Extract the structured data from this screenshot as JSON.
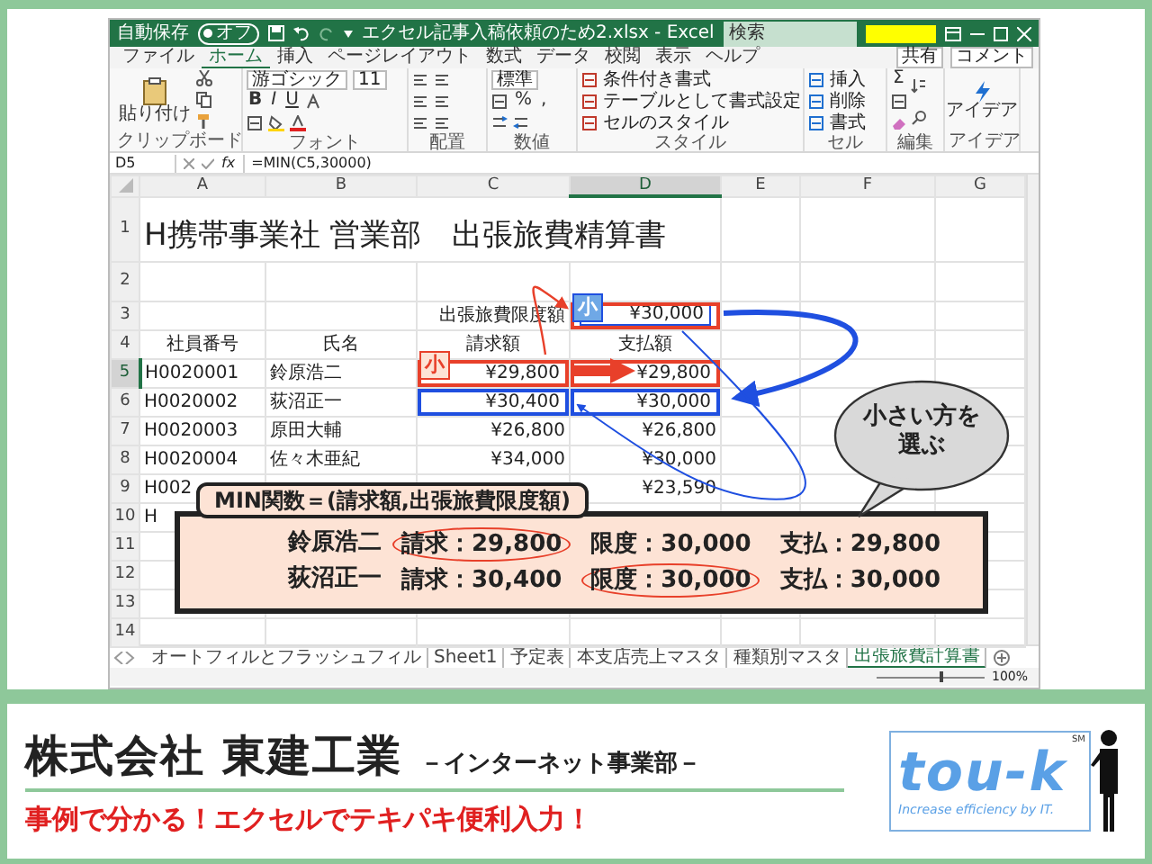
{
  "window": {
    "autosave_label": "自動保存",
    "autosave_on": false,
    "autosave_state": "オフ",
    "title": "エクセル記事入稿依頼のため2.xlsx - Excel",
    "search_placeholder": "検索"
  },
  "ribbon": {
    "tabs": [
      {
        "label": "ファイル",
        "selected": false
      },
      {
        "label": "ホーム",
        "selected": true
      },
      {
        "label": "挿入",
        "selected": false
      },
      {
        "label": "ページレイアウト",
        "selected": false
      },
      {
        "label": "数式",
        "selected": false
      },
      {
        "label": "データ",
        "selected": false
      },
      {
        "label": "校閲",
        "selected": false
      },
      {
        "label": "表示",
        "selected": false
      },
      {
        "label": "ヘルプ",
        "selected": false
      }
    ],
    "share": "共有",
    "comments": "コメント",
    "groups": [
      {
        "kind": "clipboard",
        "label": "クリップボード",
        "paste": "貼り付け"
      },
      {
        "kind": "font",
        "label": "フォント",
        "font_name": "游ゴシック",
        "font_size": "11",
        "buttons": [
          "B",
          "I",
          "U"
        ]
      },
      {
        "kind": "alignment",
        "label": "配置"
      },
      {
        "kind": "number",
        "label": "数値",
        "format": "標準",
        "buttons": [
          "%",
          ","
        ]
      },
      {
        "kind": "styles",
        "label": "スタイル",
        "items": [
          "条件付き書式",
          "テーブルとして書式設定",
          "セルのスタイル"
        ]
      },
      {
        "kind": "cells",
        "label": "セル",
        "items": [
          "挿入",
          "削除",
          "書式"
        ]
      },
      {
        "kind": "editing",
        "label": "編集",
        "buttons": [
          "Σ"
        ]
      },
      {
        "kind": "ideas",
        "label": "アイデア",
        "button": "アイデア"
      }
    ]
  },
  "formula_bar": {
    "name_box": "D5",
    "fx": "fx",
    "formula": "=MIN(C5,30000)"
  },
  "sheet": {
    "columns": [
      {
        "label": "A",
        "selected": false
      },
      {
        "label": "B",
        "selected": false
      },
      {
        "label": "C",
        "selected": false
      },
      {
        "label": "D",
        "selected": true
      },
      {
        "label": "E",
        "selected": false
      },
      {
        "label": "F",
        "selected": false
      },
      {
        "label": "G",
        "selected": false
      }
    ],
    "rows": [
      {
        "header": "1",
        "selected": false,
        "cells": [
          {
            "text": "H携帯事業社 営業部　出張旅費精算書",
            "kind": "title",
            "colspan": 4
          },
          null,
          null,
          null
        ]
      },
      {
        "header": "2",
        "selected": false,
        "cells": [
          null,
          null,
          null,
          null,
          null,
          null,
          null
        ]
      },
      {
        "header": "3",
        "selected": false,
        "cells": [
          null,
          null,
          {
            "text": "出張旅費限度額",
            "kind": "label"
          },
          {
            "text": "¥30,000",
            "kind": "amount",
            "outline": {
              "color": "#e8402a"
            },
            "inner_outline": {
              "color": "#1f4fe0"
            },
            "badge": {
              "text": "小",
              "kind": "blue"
            }
          },
          null,
          null,
          null
        ]
      },
      {
        "header": "4",
        "selected": false,
        "cells": [
          {
            "text": "社員番号",
            "kind": "header"
          },
          {
            "text": "氏名",
            "kind": "header"
          },
          {
            "text": "請求額",
            "kind": "header"
          },
          {
            "text": "支払額",
            "kind": "header"
          },
          null,
          null,
          null
        ]
      },
      {
        "header": "5",
        "selected": true,
        "cells": [
          {
            "text": "H0020001",
            "kind": "text"
          },
          {
            "text": "鈴原浩二",
            "kind": "text"
          },
          {
            "text": "¥29,800",
            "kind": "amount",
            "outline": {
              "color": "#e8402a"
            },
            "badge": {
              "text": "小",
              "kind": "red"
            }
          },
          {
            "text": "¥29,800",
            "kind": "amount",
            "outline": {
              "color": "#e8402a"
            }
          },
          null,
          null,
          null
        ]
      },
      {
        "header": "6",
        "selected": false,
        "cells": [
          {
            "text": "H0020002",
            "kind": "text"
          },
          {
            "text": "荻沼正一",
            "kind": "text"
          },
          {
            "text": "¥30,400",
            "kind": "amount",
            "outline": {
              "color": "#1f4fe0"
            }
          },
          {
            "text": "¥30,000",
            "kind": "amount",
            "outline": {
              "color": "#1f4fe0"
            }
          },
          null,
          null,
          null
        ]
      },
      {
        "header": "7",
        "selected": false,
        "cells": [
          {
            "text": "H0020003",
            "kind": "text"
          },
          {
            "text": "原田大輔",
            "kind": "text"
          },
          {
            "text": "¥26,800",
            "kind": "amount"
          },
          {
            "text": "¥26,800",
            "kind": "amount"
          },
          null,
          null,
          null
        ]
      },
      {
        "header": "8",
        "selected": false,
        "cells": [
          {
            "text": "H0020004",
            "kind": "text"
          },
          {
            "text": "佐々木亜紀",
            "kind": "text"
          },
          {
            "text": "¥34,000",
            "kind": "amount"
          },
          {
            "text": "¥30,000",
            "kind": "amount"
          },
          null,
          null,
          null
        ]
      },
      {
        "header": "9",
        "selected": false,
        "cells": [
          {
            "text": "H002",
            "kind": "text"
          },
          null,
          null,
          {
            "text": "¥23,590",
            "kind": "amount"
          },
          null,
          null,
          null
        ]
      },
      {
        "header": "10",
        "selected": false,
        "cells": [
          {
            "text": "H",
            "kind": "text"
          },
          null,
          null,
          null,
          null,
          null,
          null
        ]
      },
      {
        "header": "11",
        "selected": false,
        "cells": [
          null,
          null,
          null,
          null,
          null,
          null,
          null
        ]
      },
      {
        "header": "12",
        "selected": false,
        "cells": [
          null,
          null,
          null,
          null,
          null,
          null,
          null
        ]
      },
      {
        "header": "13",
        "selected": false,
        "cells": [
          null,
          null,
          null,
          null,
          null,
          null,
          null
        ]
      },
      {
        "header": "14",
        "selected": false,
        "cells": [
          null,
          null,
          null,
          null,
          null,
          null,
          null
        ]
      }
    ]
  },
  "callout": {
    "title": "MIN関数＝(請求額,出張旅費限度額)",
    "lines": [
      {
        "name": "鈴原浩二",
        "items": [
          {
            "text": "請求：29,800",
            "circled": true
          },
          {
            "text": "限度：30,000",
            "circled": false
          },
          {
            "text": "支払：29,800",
            "circled": false
          }
        ]
      },
      {
        "name": "荻沼正一",
        "items": [
          {
            "text": "請求：30,400",
            "circled": false
          },
          {
            "text": "限度：30,000",
            "circled": true
          },
          {
            "text": "支払：30,000",
            "circled": false
          }
        ]
      }
    ]
  },
  "bubble": {
    "lines": [
      "小さい方を",
      "選ぶ"
    ]
  },
  "sheet_tabs": [
    {
      "label": "オートフィルとフラッシュフィル",
      "selected": false
    },
    {
      "label": "Sheet1",
      "selected": false
    },
    {
      "label": "予定表",
      "selected": false
    },
    {
      "label": "本支店売上マスタ",
      "selected": false
    },
    {
      "label": "種類別マスタ",
      "selected": false
    },
    {
      "label": "出張旅費計算書",
      "selected": true
    }
  ],
  "status_bar": {
    "zoom_slider": {
      "level": 0.6
    },
    "zoom": "100%"
  },
  "footer": {
    "company": "株式会社 東建工業",
    "division": "－インターネット事業部－",
    "tagline": "事例で分かる！エクセルでテキパキ便利入力！",
    "logo": {
      "text": "tou-k",
      "mark": "SM",
      "slogan": "Increase efficiency by IT."
    }
  }
}
